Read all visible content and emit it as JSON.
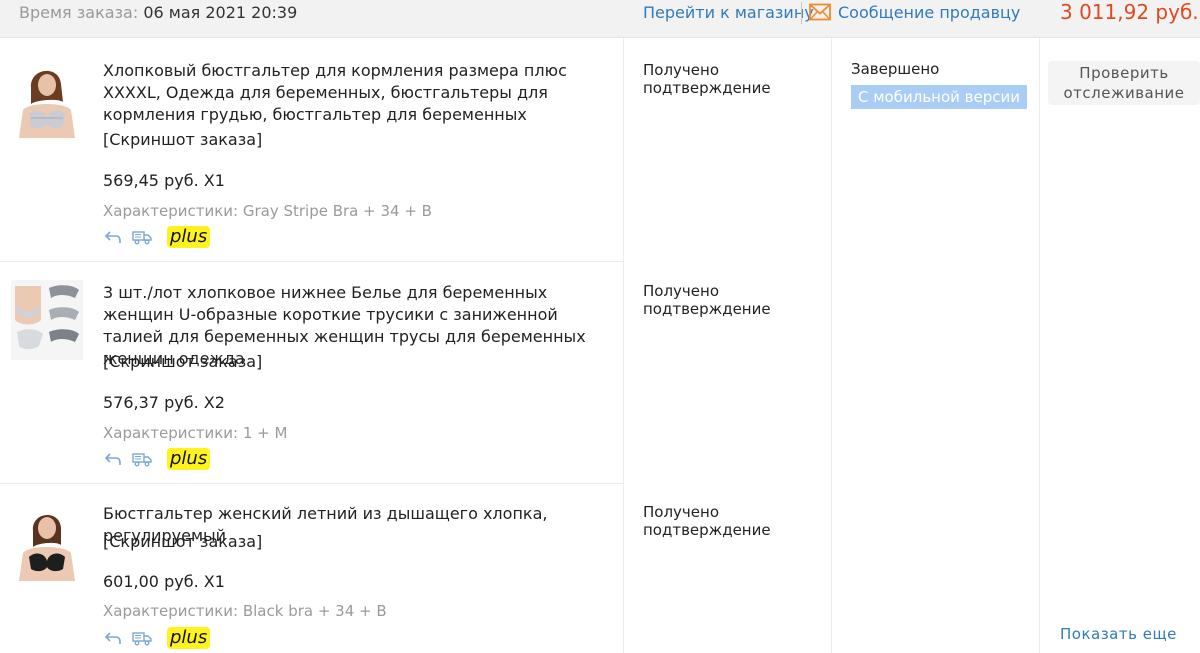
{
  "header": {
    "order_time_label": "Время заказа:",
    "order_time_value": "06 мая 2021 20:39",
    "store_link": "Перейти к магазину",
    "message_seller": "Сообщение продавцу",
    "total": "3 011,92 руб."
  },
  "items": [
    {
      "title": "Хлопковый бюстгальтер для кормления размера плюс XXXXL, Одежда для беременных, бюстгальтеры для кормления грудью, бюстгальтер для беременных",
      "snapshot": "[Скриншот заказа]",
      "price": "569,45 руб. X1",
      "specs": "Характеристики: Gray Stripe Bra + 34 + B",
      "badge": "plus",
      "status": "Получено подтверждение"
    },
    {
      "title": "3 шт./лот хлопковое нижнее Белье для беременных женщин U-образные короткие трусики с заниженной талией для беременных женщин трусы для беременных женщин одежда",
      "snapshot": "[Скриншот заказа]",
      "price": "576,37 руб. X2",
      "specs": "Характеристики: 1 + M",
      "badge": "plus",
      "status": "Получено подтверждение"
    },
    {
      "title": "Бюстгальтер женский летний из дышащего хлопка, регулируемый",
      "snapshot": "[Скриншот заказа]",
      "price": "601,00 руб. X1",
      "specs": "Характеристики: Black bra + 34 + B",
      "badge": "plus",
      "status": "Получено подтверждение"
    }
  ],
  "order": {
    "state": "Завершено",
    "mobile_badge": "С мобильной версии",
    "track_button": "Проверить отслеживание",
    "show_more": "Показать еще"
  },
  "colors": {
    "link": "#2f7bbd",
    "total": "#e0491f",
    "plus_badge": "#fff31f",
    "mobile_badge": "#a9cdf4",
    "muted": "#9a9a9a"
  },
  "icons": [
    "mail-icon",
    "return-icon",
    "truck-icon"
  ]
}
